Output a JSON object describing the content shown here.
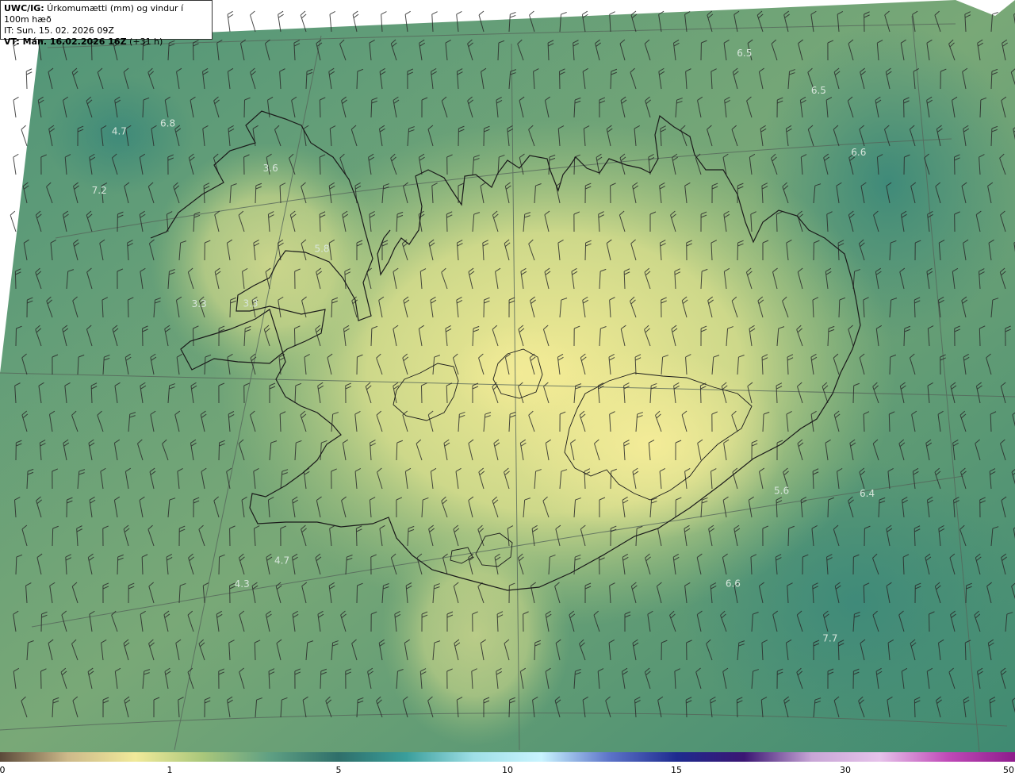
{
  "header": {
    "product_prefix": "UWC/IG:",
    "title": " Úrkomumætti (mm) og vindur í 100m hæð",
    "init_time": "IT: Sun. 15. 02. 2026 09Z",
    "valid_prefix": "VT: Mán. 16.02.2026 16Z",
    "valid_suffix": " (+31 h)"
  },
  "map_labels": [
    {
      "text": "6.5",
      "lon": -14.85,
      "lat": 67.55
    },
    {
      "text": "6.5",
      "lon": -13.55,
      "lat": 67.13
    },
    {
      "text": "6.6",
      "lon": -12.85,
      "lat": 66.53
    },
    {
      "text": "6.8",
      "lon": -24.95,
      "lat": 66.8
    },
    {
      "text": "4.7",
      "lon": -25.8,
      "lat": 66.65
    },
    {
      "text": "3.6",
      "lon": -23.15,
      "lat": 66.55
    },
    {
      "text": "7.2",
      "lon": -26.15,
      "lat": 66.1
    },
    {
      "text": "5.8",
      "lon": -22.25,
      "lat": 65.9
    },
    {
      "text": "3.3",
      "lon": -23.5,
      "lat": 65.35
    },
    {
      "text": "3.3",
      "lon": -24.4,
      "lat": 65.28
    },
    {
      "text": "5.6",
      "lon": -14.2,
      "lat": 63.7
    },
    {
      "text": "6.4",
      "lon": -12.7,
      "lat": 63.55
    },
    {
      "text": "4.7",
      "lon": -22.95,
      "lat": 63.15
    },
    {
      "text": "4.3",
      "lon": -23.65,
      "lat": 62.9
    },
    {
      "text": "6.6",
      "lon": -15.05,
      "lat": 62.95
    },
    {
      "text": "7.7",
      "lon": -13.35,
      "lat": 62.35
    }
  ],
  "colorbar": {
    "ticks": [
      "0",
      "1",
      "5",
      "10",
      "15",
      "30",
      "50"
    ],
    "colors": [
      "#5b4a3a",
      "#cdb98a",
      "#f1ea9a",
      "#a9c77b",
      "#5e9f83",
      "#2f6f6a",
      "#3a9e9b",
      "#9fdfe6",
      "#c9f4ff",
      "#5d74c9",
      "#1e2b8f",
      "#3b1673",
      "#c8a6d6",
      "#e6c2ea",
      "#c04ab8",
      "#8e1c8c"
    ]
  }
}
